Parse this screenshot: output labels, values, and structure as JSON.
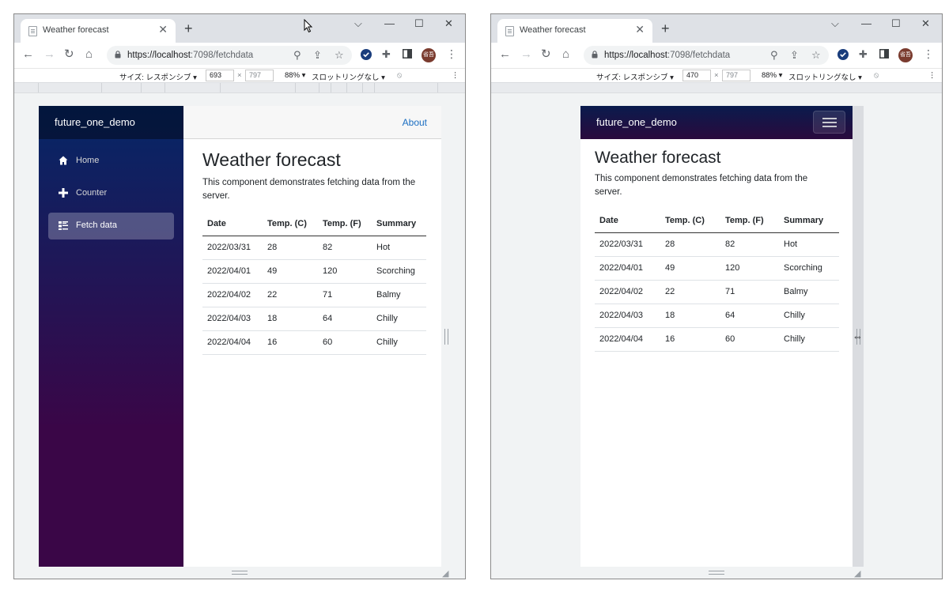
{
  "browser": {
    "tab_title": "Weather forecast",
    "url_host": "https://localhost",
    "url_rest": ":7098/fetchdata",
    "profile_label": "省吾"
  },
  "device_toolbar": {
    "size_label": "サイズ: レスポンシブ ▾",
    "zoom": "88% ▾",
    "throttle": "スロットリングなし ▾",
    "separator": "×"
  },
  "left": {
    "width": "693",
    "height": "797"
  },
  "right": {
    "width": "470",
    "height": "797"
  },
  "app": {
    "brand": "future_one_demo",
    "about": "About",
    "nav": [
      {
        "label": "Home",
        "icon": "home-icon"
      },
      {
        "label": "Counter",
        "icon": "plus-icon"
      },
      {
        "label": "Fetch data",
        "icon": "list-icon"
      }
    ],
    "heading": "Weather forecast",
    "description": "This component demonstrates fetching data from the server.",
    "description_line1": "This component demonstrates fetching data from the",
    "description_line2": "server.",
    "columns": [
      "Date",
      "Temp. (C)",
      "Temp. (F)",
      "Summary"
    ],
    "rows": [
      [
        "2022/03/31",
        "28",
        "82",
        "Hot"
      ],
      [
        "2022/04/01",
        "49",
        "120",
        "Scorching"
      ],
      [
        "2022/04/02",
        "22",
        "71",
        "Balmy"
      ],
      [
        "2022/04/03",
        "18",
        "64",
        "Chilly"
      ],
      [
        "2022/04/04",
        "16",
        "60",
        "Chilly"
      ]
    ]
  }
}
